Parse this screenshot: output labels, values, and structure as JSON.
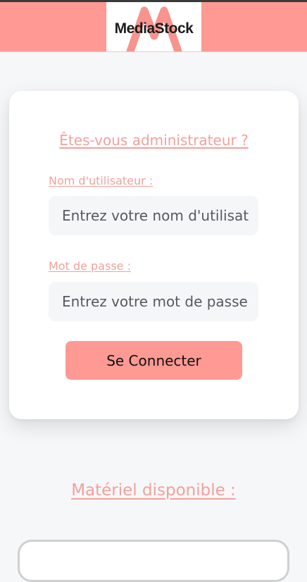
{
  "header": {
    "logo_text": "MediaStock",
    "brand_color": "#ff9994"
  },
  "login": {
    "admin_link": "Êtes-vous administrateur ?",
    "username_label": "Nom d'utilisateur :",
    "username_placeholder": "Entrez votre nom d'utilisateur",
    "password_label": "Mot de passe :",
    "password_placeholder": "Entrez votre mot de passe",
    "submit_label": "Se Connecter"
  },
  "materials": {
    "title": "Matériel disponible :"
  }
}
